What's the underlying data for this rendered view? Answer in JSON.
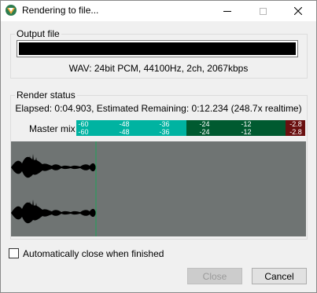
{
  "window": {
    "title": "Rendering to file..."
  },
  "output_group": {
    "label": "Output file",
    "file_path": "",
    "format": "WAV: 24bit PCM, 44100Hz, 2ch, 2067kbps"
  },
  "render_group": {
    "label": "Render status",
    "elapsed": "Elapsed: 0:04.903, Estimated Remaining: 0:12.234 (248.7x realtime)",
    "master_label": "Master mix",
    "meter_scale": [
      "-60",
      "-48",
      "-36",
      "-24",
      "-12"
    ],
    "peak_values": [
      "-2.8",
      "-2.8"
    ],
    "render_progress": 0.287
  },
  "auto_close": {
    "label": "Automatically close when finished",
    "checked": false
  },
  "buttons": {
    "close": "Close",
    "cancel": "Cancel"
  },
  "colors": {
    "meter_teal": "#00b3a1",
    "meter_dark_green": "#005a30",
    "meter_peak_red": "#6a1010",
    "waveform_bg": "#6f7473",
    "progress_cursor": "#1fa35a"
  }
}
